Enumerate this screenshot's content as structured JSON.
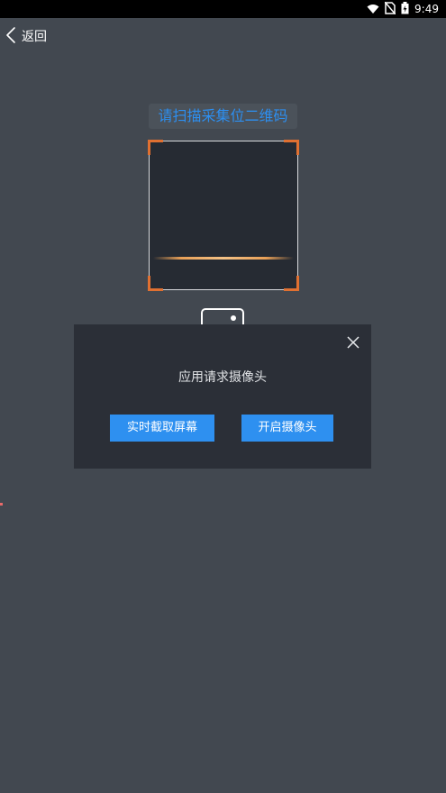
{
  "status_bar": {
    "time": "9:49",
    "icons": [
      "wifi-icon",
      "no-sim-icon",
      "battery-charging-icon"
    ]
  },
  "nav": {
    "back_label": "返回",
    "back_icon": "chevron-left-icon"
  },
  "scanner": {
    "title": "请扫描采集位二维码",
    "title_color": "#2d8ff0",
    "corner_color": "#e07031"
  },
  "dialog": {
    "message": "应用请求摄像头",
    "close_icon": "close-icon",
    "buttons": {
      "screen_capture_label": "实时截取屏幕",
      "open_camera_label": "开启摄像头"
    },
    "button_color": "#2e90f0"
  },
  "colors": {
    "background": "#424850",
    "dialog_background": "#2b2f37"
  }
}
